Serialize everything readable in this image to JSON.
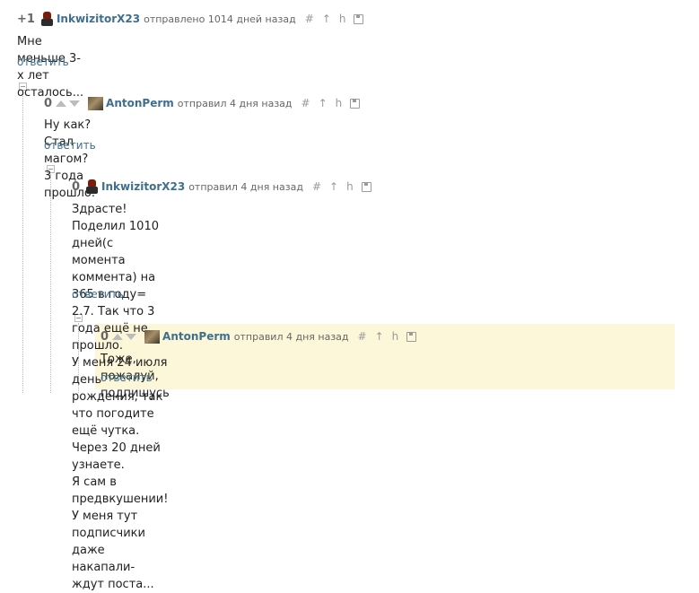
{
  "comments": [
    {
      "rating": "+1",
      "user": "InkwizitorX23",
      "sent": "отправлено 1014 дней назад",
      "lines": [
        "Мне меньше 3-х лет осталось..."
      ],
      "reply": "ответить",
      "avatar": "helmet-avatar"
    },
    {
      "rating": "0",
      "user": "AntonPerm",
      "sent": "отправил 4 дня назад",
      "lines": [
        "Ну как? Стал магом? 3 года прошло."
      ],
      "reply": "ответить",
      "avatar": "photo-avatar"
    },
    {
      "rating": "0",
      "user": "InkwizitorX23",
      "sent": "отправил 4 дня назад",
      "lines": [
        "Здрасте!",
        "Поделил 1010 дней(с момента коммента) на 365 в году= 2.7. Так что 3 года ещё не прошло.",
        "У меня 24 июля день рождения, так что погодите ещё чутка. Через 20 дней узнаете.",
        "Я сам в предвкушении!",
        "У меня тут подписчики даже накапали- ждут поста..."
      ],
      "reply": "ответить",
      "avatar": "helmet-avatar"
    },
    {
      "rating": "0",
      "user": "AntonPerm",
      "sent": "отправил 4 дня назад",
      "lines": [
        "Тоже, пожалуй, подпишусь"
      ],
      "reply": "ответить",
      "avatar": "photo-avatar"
    }
  ],
  "tools": {
    "hash": "#",
    "arrow": "↑",
    "link": "h"
  },
  "colors": {
    "username": "#3f6f8e",
    "highlight": "#fcf7d9",
    "meta": "#666666"
  }
}
